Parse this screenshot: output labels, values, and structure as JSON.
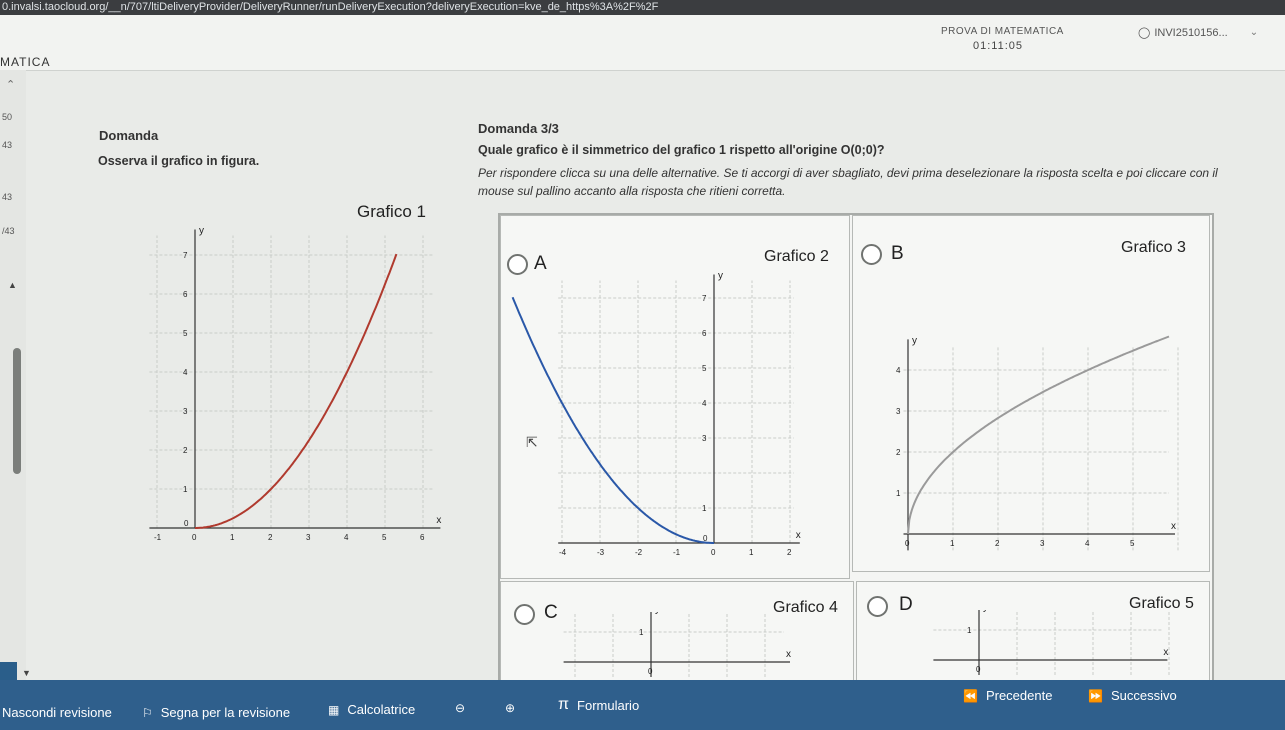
{
  "browser": {
    "url": "0.invalsi.taocloud.org/__n/707/ltiDeliveryProvider/DeliveryRunner/runDeliveryExecution?deliveryExecution=kve_de_https%3A%2F%2F"
  },
  "header": {
    "section": "MATICA",
    "test_name": "PROVA DI MATEMATICA",
    "timer": "01:11:05",
    "user": "INVI2510156..."
  },
  "sidebar": {
    "rows": [
      "50",
      "43",
      "43",
      "/43"
    ]
  },
  "left": {
    "label": "Domanda",
    "prompt": "Osserva il grafico in figura.",
    "caption": "Grafico 1"
  },
  "question": {
    "number": "Domanda 3/3",
    "text": "Quale grafico è il simmetrico del grafico 1 rispetto all'origine O(0;0)?",
    "instructions": "Per rispondere clicca su una delle alternative. Se ti accorgi di aver sbagliato, devi prima deselezionare la risposta scelta e poi cliccare con il mouse sul pallino accanto alla risposta che ritieni corretta."
  },
  "options": [
    {
      "letter": "A",
      "caption": "Grafico 2"
    },
    {
      "letter": "B",
      "caption": "Grafico 3"
    },
    {
      "letter": "C",
      "caption": "Grafico 4"
    },
    {
      "letter": "D",
      "caption": "Grafico 5"
    }
  ],
  "graph_labels": {
    "x": "x",
    "y": "y"
  },
  "graph1_ticks": {
    "x": [
      "-1",
      "0",
      "1",
      "2",
      "3",
      "4",
      "5",
      "6"
    ],
    "y": [
      "0",
      "1",
      "2",
      "3",
      "4",
      "5",
      "6",
      "7"
    ]
  },
  "graph2_ticks": {
    "x": [
      "-4",
      "-3",
      "-2",
      "-1",
      "0",
      "1",
      "2"
    ],
    "y": [
      "0",
      "1",
      "3",
      "4",
      "5",
      "6",
      "7"
    ]
  },
  "graph3_ticks": {
    "x": [
      "0",
      "1",
      "2",
      "3",
      "4",
      "5"
    ],
    "y": [
      "0",
      "1",
      "2",
      "3",
      "4"
    ]
  },
  "graph4_ticks": {
    "x": [
      "0"
    ],
    "y": [
      "1"
    ]
  },
  "graph5_ticks": {
    "x": [
      "0"
    ],
    "y": [
      "1"
    ]
  },
  "footer": {
    "hide": "Nascondi revisione",
    "flag": "Segna per la revisione",
    "calculator": "Calcolatrice",
    "formulary": "Formulario",
    "prev": "Precedente",
    "next": "Successivo"
  },
  "icons": {
    "flag": "flag-icon",
    "calculator": "calculator-icon",
    "zoom_out": "zoom-out-icon",
    "zoom_in": "zoom-in-icon",
    "pi": "pi-icon",
    "prev": "rewind-icon",
    "next": "fast-forward-icon",
    "user": "user-icon",
    "cursor": "mouse-pointer-icon"
  },
  "colors": {
    "footer": "#2f5f8c",
    "curve_red": "#b03a2e",
    "curve_blue": "#2a58a8",
    "curve_gray": "#9a9a9a"
  }
}
